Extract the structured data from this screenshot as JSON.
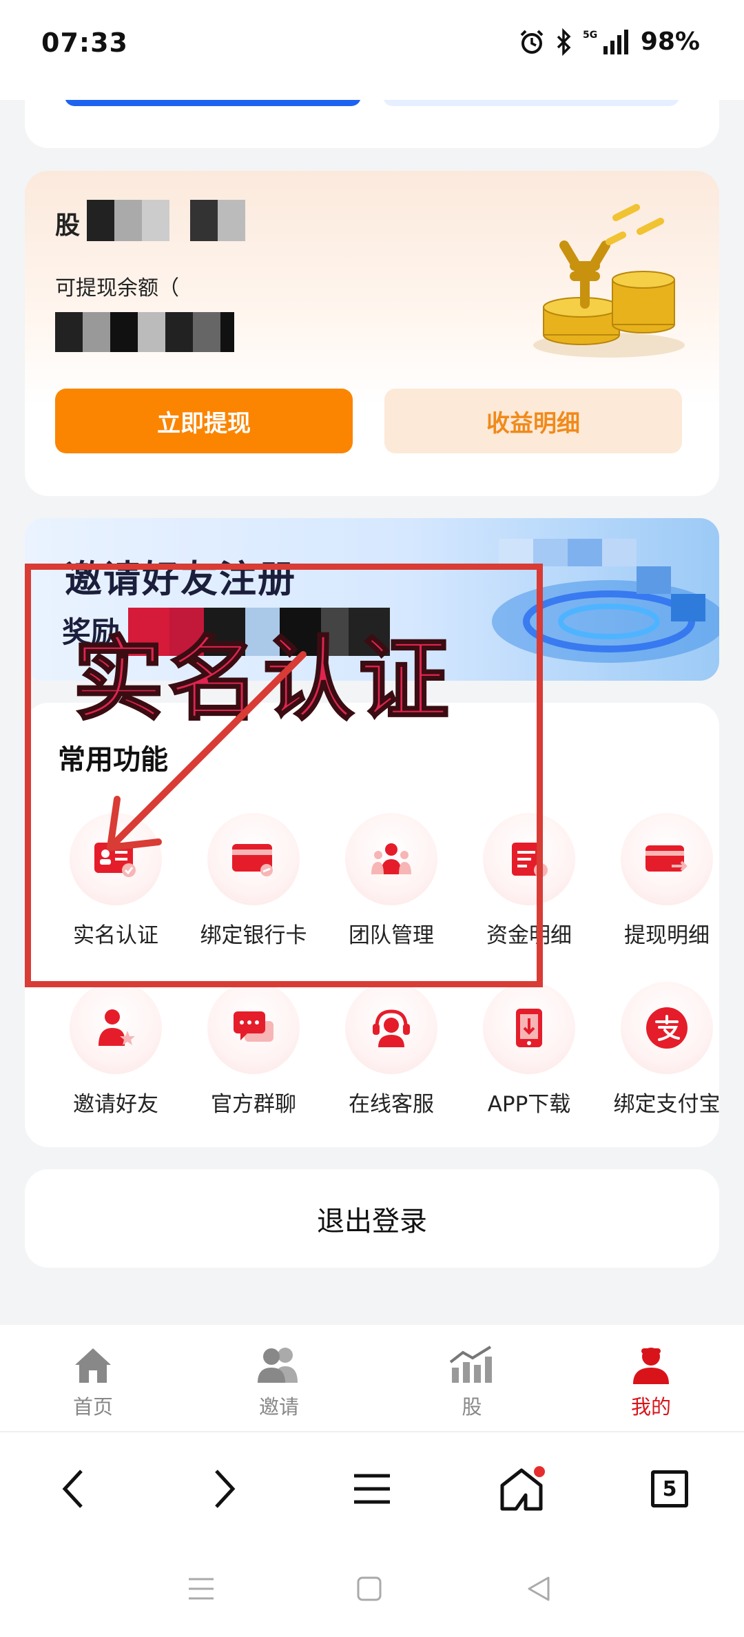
{
  "status_bar": {
    "time": "07:33",
    "network": "5G",
    "battery": "98%"
  },
  "balance_card": {
    "label_top": "股",
    "label_withdrawable": "可提现余额（",
    "withdraw_button": "立即提现",
    "detail_button": "收益明细"
  },
  "banner": {
    "title": "邀请好友注册",
    "subtitle": "奖励"
  },
  "functions": {
    "title": "常用功能",
    "row1": [
      {
        "label": "实名认证",
        "icon": "id-card-icon"
      },
      {
        "label": "绑定银行卡",
        "icon": "bank-card-icon"
      },
      {
        "label": "团队管理",
        "icon": "team-icon"
      },
      {
        "label": "资金明细",
        "icon": "fund-detail-icon"
      },
      {
        "label": "提现明细",
        "icon": "withdraw-detail-icon"
      }
    ],
    "row2": [
      {
        "label": "邀请好友",
        "icon": "invite-friend-icon"
      },
      {
        "label": "官方群聊",
        "icon": "group-chat-icon"
      },
      {
        "label": "在线客服",
        "icon": "customer-service-icon"
      },
      {
        "label": "APP下载",
        "icon": "app-download-icon"
      },
      {
        "label": "绑定支付宝",
        "icon": "alipay-icon"
      }
    ]
  },
  "logout": {
    "label": "退出登录"
  },
  "tabbar": {
    "items": [
      {
        "label": "首页",
        "icon": "home-icon"
      },
      {
        "label": "邀请",
        "icon": "users-icon"
      },
      {
        "label": "股",
        "icon": "chart-icon"
      },
      {
        "label": "我的",
        "icon": "profile-icon"
      }
    ],
    "active": "我的",
    "active_color": "#d8141a"
  },
  "browser": {
    "tab_count": "5"
  },
  "annotation": {
    "text": "实名认证",
    "color": "#e02450"
  }
}
